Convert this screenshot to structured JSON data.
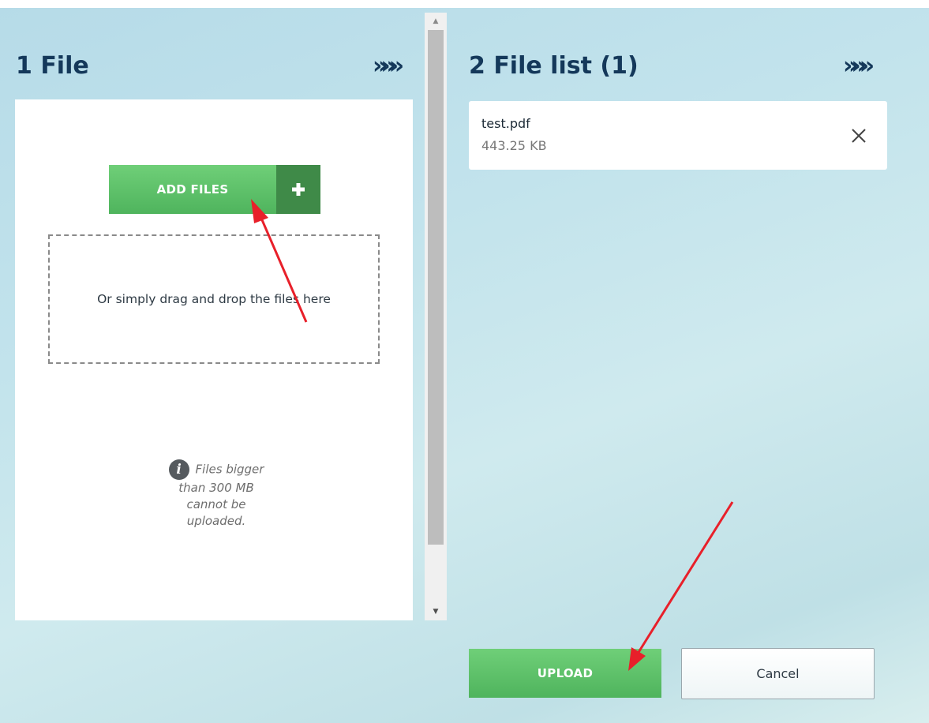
{
  "left_panel": {
    "title": "1 File",
    "chevrons": "»»»",
    "add_files_label": "ADD FILES",
    "add_plus": "+",
    "dropzone_text": "Or simply drag and drop the files here",
    "info_line1": "Files bigger",
    "info_line2": "than 300 MB",
    "info_line3": "cannot be",
    "info_line4": "uploaded.",
    "info_icon_glyph": "i"
  },
  "right_panel": {
    "title": "2 File list (1)",
    "chevrons": "»»»",
    "files": [
      {
        "name": "test.pdf",
        "size": "443.25 KB"
      }
    ],
    "upload_label": "UPLOAD",
    "cancel_label": "Cancel"
  },
  "colors": {
    "title": "#14385a",
    "green": "#5cbf68",
    "green_dark": "#3f8a48",
    "annotation_arrow": "#e8202a"
  }
}
